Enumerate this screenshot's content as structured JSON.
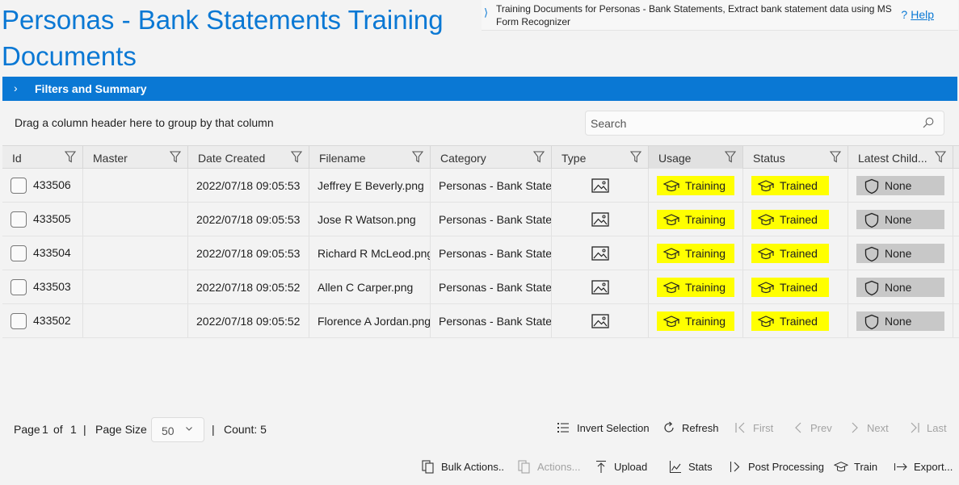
{
  "page": {
    "title": "Personas - Bank Statements Training Documents",
    "description": "Training Documents for Personas - Bank Statements, Extract bank statement data using MS Form Recognizer",
    "help_label": "Help",
    "help_icon": "?",
    "desc_chevron": "⟩"
  },
  "filters": {
    "label": "Filters and Summary",
    "chevron": "›"
  },
  "grid": {
    "group_hint": "Drag a column header here to group by that column",
    "search_placeholder": "Search",
    "columns": [
      "Id",
      "Master",
      "Date Created",
      "Filename",
      "Category",
      "Type",
      "Usage",
      "Status",
      "Latest Child..."
    ],
    "rows": [
      {
        "id": "433506",
        "master": "",
        "date": "2022/07/18 09:05:53",
        "filename": "Jeffrey E Beverly.png",
        "category": "Personas - Bank Statements",
        "type": "image-icon",
        "usage": "Training",
        "status": "Trained",
        "child": "None"
      },
      {
        "id": "433505",
        "master": "",
        "date": "2022/07/18 09:05:53",
        "filename": "Jose R Watson.png",
        "category": "Personas - Bank Statements",
        "type": "image-icon",
        "usage": "Training",
        "status": "Trained",
        "child": "None"
      },
      {
        "id": "433504",
        "master": "",
        "date": "2022/07/18 09:05:53",
        "filename": "Richard R McLeod.png",
        "category": "Personas - Bank Statements",
        "type": "image-icon",
        "usage": "Training",
        "status": "Trained",
        "child": "None"
      },
      {
        "id": "433503",
        "master": "",
        "date": "2022/07/18 09:05:52",
        "filename": "Allen C Carper.png",
        "category": "Personas - Bank Statements",
        "type": "image-icon",
        "usage": "Training",
        "status": "Trained",
        "child": "None"
      },
      {
        "id": "433502",
        "master": "",
        "date": "2022/07/18 09:05:52",
        "filename": "Florence A Jordan.png",
        "category": "Personas - Bank Statements",
        "type": "image-icon",
        "usage": "Training",
        "status": "Trained",
        "child": "None"
      }
    ],
    "colors": {
      "usage_badge": "#ffff00",
      "status_badge": "#ffff00",
      "child_badge": "#c8c8c8",
      "accent": "#0a78d4"
    }
  },
  "pager": {
    "page_label": "Page",
    "page": "1",
    "of_label": "of",
    "total_pages": "1",
    "sep": "|",
    "page_size_label": "Page Size",
    "page_size": "50",
    "count_label": "Count: 5",
    "invert_selection": "Invert Selection",
    "refresh": "Refresh",
    "first": "First",
    "prev": "Prev",
    "next": "Next",
    "last": "Last"
  },
  "toolbar": {
    "bulk_actions": "Bulk Actions..",
    "actions": "Actions...",
    "upload": "Upload",
    "stats": "Stats",
    "post_processing": "Post Processing",
    "train": "Train",
    "export": "Export..."
  }
}
